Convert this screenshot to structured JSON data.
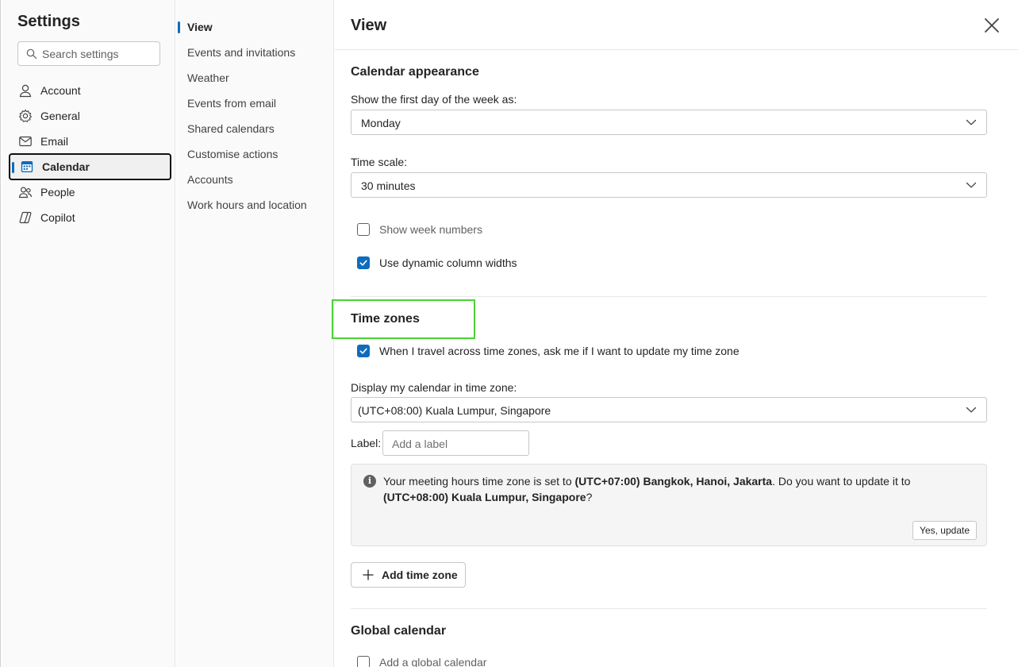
{
  "leftnav": {
    "title": "Settings",
    "search_placeholder": "Search settings",
    "items": [
      {
        "label": "Account",
        "icon": "person-icon"
      },
      {
        "label": "General",
        "icon": "gear-icon"
      },
      {
        "label": "Email",
        "icon": "mail-icon"
      },
      {
        "label": "Calendar",
        "icon": "calendar-icon",
        "active": true
      },
      {
        "label": "People",
        "icon": "people-icon"
      },
      {
        "label": "Copilot",
        "icon": "copilot-icon"
      }
    ]
  },
  "subnav": {
    "items": [
      {
        "label": "View",
        "active": true
      },
      {
        "label": "Events and invitations"
      },
      {
        "label": "Weather"
      },
      {
        "label": "Events from email"
      },
      {
        "label": "Shared calendars"
      },
      {
        "label": "Customise actions"
      },
      {
        "label": "Accounts"
      },
      {
        "label": "Work hours and location"
      }
    ]
  },
  "main": {
    "title": "View",
    "appearance": {
      "title": "Calendar appearance",
      "first_day_label": "Show the first day of the week as:",
      "first_day_value": "Monday",
      "time_scale_label": "Time scale:",
      "time_scale_value": "30 minutes",
      "show_week_numbers": "Show week numbers",
      "show_week_numbers_checked": false,
      "dynamic_columns": "Use dynamic column widths",
      "dynamic_columns_checked": true
    },
    "timezones": {
      "title": "Time zones",
      "travel_prompt": "When I travel across time zones, ask me if I want to update my time zone",
      "travel_prompt_checked": true,
      "display_label": "Display my calendar in time zone:",
      "display_value": "(UTC+08:00) Kuala Lumpur, Singapore",
      "label_label": "Label:",
      "label_placeholder": "Add a label",
      "info": {
        "part1": "Your meeting hours time zone is set to ",
        "tz_current": "(UTC+07:00) Bangkok, Hanoi, Jakarta",
        "part2": ". Do you want to update it to ",
        "tz_new": "(UTC+08:00) Kuala Lumpur, Singapore",
        "part3": "?",
        "button": "Yes, update"
      },
      "add_button": "Add time zone"
    },
    "global": {
      "title": "Global calendar",
      "add_global": "Add a global calendar",
      "add_global_checked": false
    }
  },
  "colors": {
    "accent": "#0f6cbd",
    "highlight": "#4cd137"
  }
}
